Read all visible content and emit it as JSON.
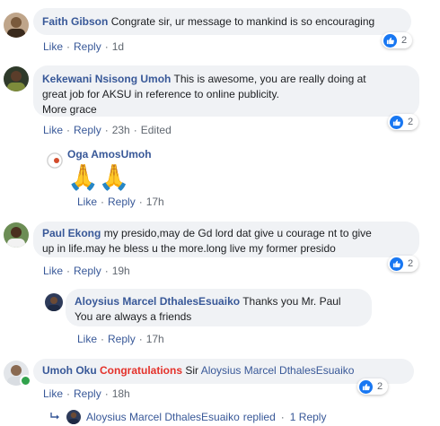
{
  "actions": {
    "like": "Like",
    "reply": "Reply"
  },
  "reaction_count": "2",
  "comments": [
    {
      "author": "Faith Gibson",
      "text": "Congrate sir, ur message to mankind is so encouraging",
      "time": "1d"
    },
    {
      "author": "Kekewani Nsisong Umoh",
      "text_line1": "This is awesome, you are really doing at",
      "text_line2": "great job for AKSU in reference to online publicity.",
      "text_line3": "More grace",
      "time": "23h",
      "edited": "Edited"
    },
    {
      "author": "Oga AmosUmoh",
      "emoji": "🙏🙏",
      "time": "17h"
    },
    {
      "author": "Paul Ekong",
      "text_line1": "my presido,may de Gd lord dat give u courage nt to give",
      "text_line2": "up in life.may he bless u the more.long live my former presido",
      "time": "19h"
    },
    {
      "author": "Aloysius Marcel DthalesEsuaiko",
      "text_line1": "Thanks you Mr. Paul",
      "text_line2": "You are always a friends",
      "time": "17h"
    },
    {
      "author": "Umoh Oku",
      "congrats": "Congratulations",
      "text_mid": "Sir",
      "mention": "Aloysius Marcel DthalesEsuaiko",
      "time": "18h"
    }
  ],
  "reply_summary": {
    "name": "Aloysius Marcel DthalesEsuaiko",
    "replied": "replied",
    "dot": "·",
    "count": "1 Reply"
  },
  "colors": {
    "bubble": "#f0f2f5",
    "author": "#385898",
    "like_blue": "#1877f2",
    "congrats": "#e4322b",
    "online": "#31a24c"
  }
}
